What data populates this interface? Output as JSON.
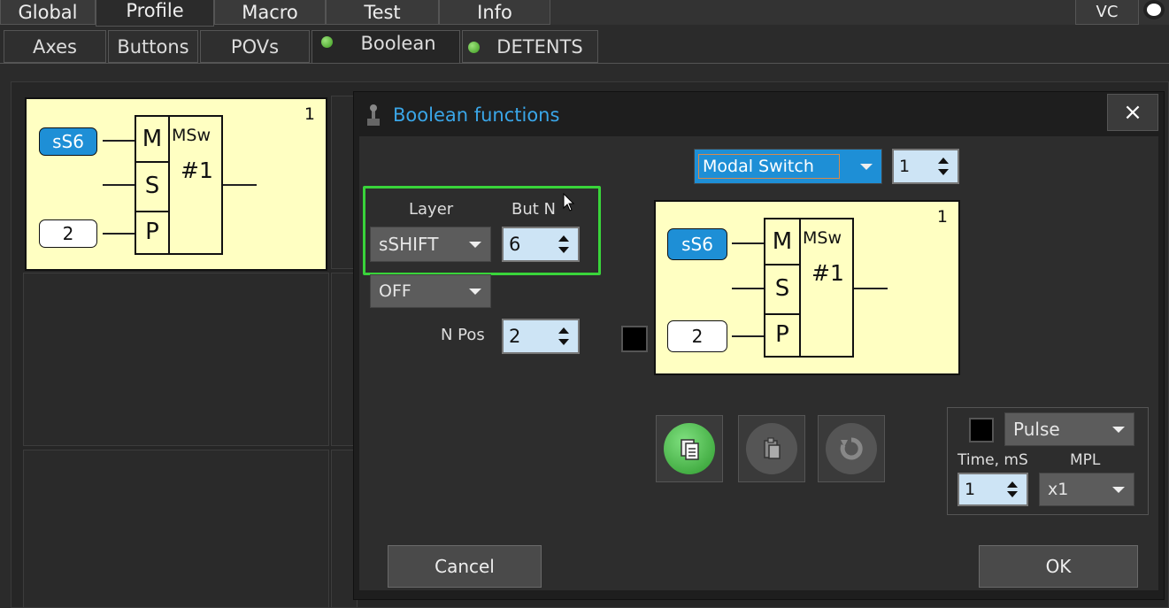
{
  "top_tabs": [
    "Global",
    "Profile",
    "Macro",
    "Test",
    "Info"
  ],
  "top_right_label": "VC",
  "sub_tabs": [
    "Axes",
    "Buttons",
    "POVs",
    "Boolean",
    "DETENTS"
  ],
  "block": {
    "number": "1",
    "input_m": "sS6",
    "input_p": "2",
    "row_m": "M",
    "row_s": "S",
    "row_p": "P",
    "gate_title": "MSw",
    "gate_id": "#1"
  },
  "dialog": {
    "title": "Boolean functions",
    "close": "×",
    "function_type": "Modal Switch",
    "function_index": "1",
    "layer_label": "Layer",
    "butn_label": "But N",
    "layer_value": "sSHIFT",
    "butn_value": "6",
    "state_value": "OFF",
    "npos_label": "N Pos",
    "npos_value": "2",
    "pulse_value": "Pulse",
    "time_label": "Time, mS",
    "mpl_label": "MPL",
    "time_value": "1",
    "mpl_value": "x1",
    "cancel": "Cancel",
    "ok": "OK"
  },
  "colors": {
    "accent_blue": "#1e8fd6",
    "title_blue": "#3aa6e8",
    "highlight_green": "#39d43a",
    "block_yellow": "#ffffc2"
  }
}
